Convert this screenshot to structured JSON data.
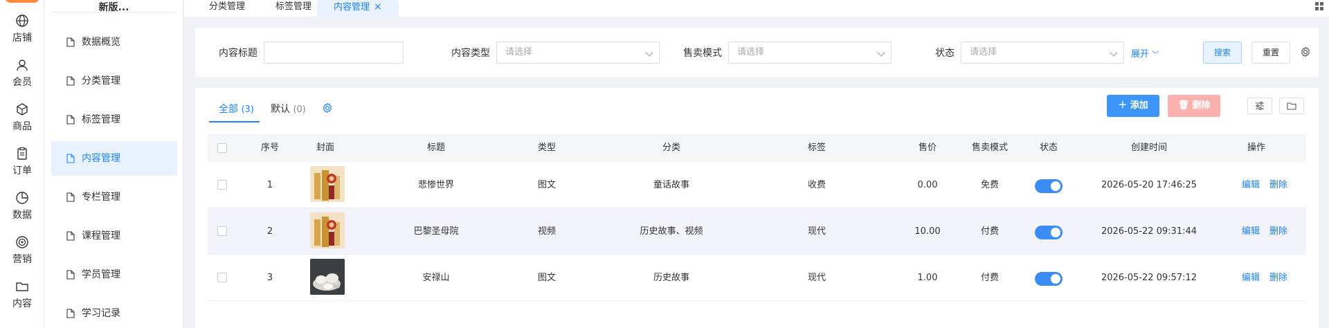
{
  "rail": {
    "items": [
      {
        "label": "店铺",
        "icon": "globe-icon"
      },
      {
        "label": "会员",
        "icon": "user-icon"
      },
      {
        "label": "商品",
        "icon": "box-icon"
      },
      {
        "label": "订单",
        "icon": "clipboard-icon"
      },
      {
        "label": "数据",
        "icon": "pie-chart-icon"
      },
      {
        "label": "营销",
        "icon": "target-icon"
      },
      {
        "label": "内容",
        "icon": "folder-icon"
      }
    ]
  },
  "submenu": {
    "title": "新版...",
    "items": [
      {
        "label": "数据概览"
      },
      {
        "label": "分类管理"
      },
      {
        "label": "标签管理"
      },
      {
        "label": "内容管理"
      },
      {
        "label": "专栏管理"
      },
      {
        "label": "课程管理"
      },
      {
        "label": "学员管理"
      },
      {
        "label": "学习记录"
      }
    ]
  },
  "tabs": [
    {
      "label": "分类管理"
    },
    {
      "label": "标签管理"
    },
    {
      "label": "内容管理"
    }
  ],
  "filter": {
    "title_label": "内容标题",
    "title_value": "",
    "type_label": "内容类型",
    "type_placeholder": "请选择",
    "mode_label": "售卖模式",
    "mode_placeholder": "请选择",
    "status_label": "状态",
    "status_placeholder": "请选择",
    "expand": "展开",
    "search": "搜索",
    "reset": "重置"
  },
  "table": {
    "tabs": [
      {
        "label": "全部",
        "count": "(3)"
      },
      {
        "label": "默认",
        "count": "(0)"
      }
    ],
    "add": "添加",
    "delete": "删除",
    "columns": {
      "index": "序号",
      "cover": "封面",
      "title": "标题",
      "type": "类型",
      "category": "分类",
      "tag": "标签",
      "price": "售价",
      "mode": "售卖模式",
      "status": "状态",
      "created": "创建时间",
      "ops": "操作"
    },
    "rows": [
      {
        "index": "1",
        "title": "悲惨世界",
        "type": "图文",
        "category": "童话故事",
        "tag": "收费",
        "price": "0.00",
        "mode": "免费",
        "status_on": true,
        "created": "2026-05-20 17:46:25",
        "edit": "编辑",
        "remove": "删除"
      },
      {
        "index": "2",
        "title": "巴黎圣母院",
        "type": "视频",
        "category": "历史故事、视频",
        "tag": "现代",
        "price": "10.00",
        "mode": "付费",
        "status_on": true,
        "created": "2026-05-22 09:31:44",
        "edit": "编辑",
        "remove": "删除"
      },
      {
        "index": "3",
        "title": "安禄山",
        "type": "图文",
        "category": "历史故事",
        "tag": "现代",
        "price": "1.00",
        "mode": "付费",
        "status_on": true,
        "created": "2026-05-22 09:57:12",
        "edit": "编辑",
        "remove": "删除"
      }
    ]
  },
  "colors": {
    "primary": "#1e80ff",
    "add_button": "#3c95f7",
    "delete_button_disabled": "#fbb0b0",
    "switch_on": "#3c8cf5",
    "active_menu_bg": "#e8f3ff"
  }
}
